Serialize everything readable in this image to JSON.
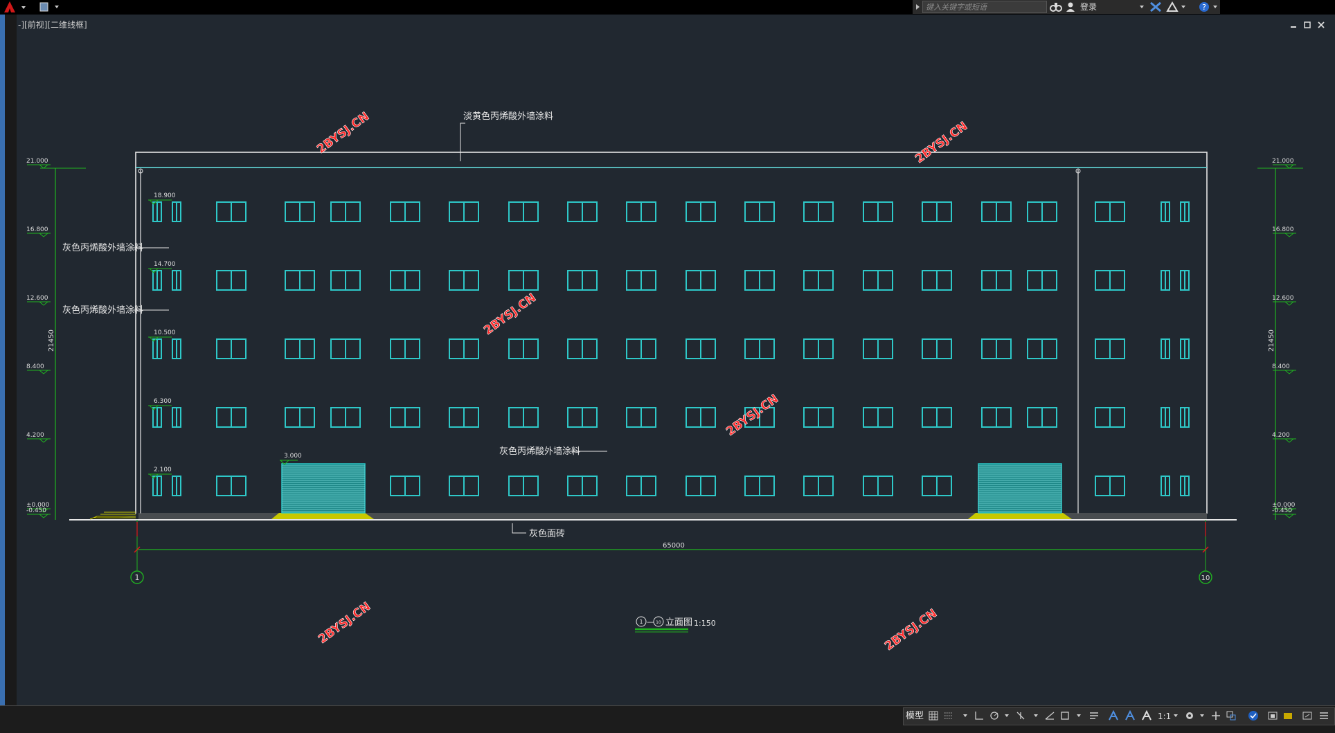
{
  "app": {
    "view_label": "-][前视][二维线框]",
    "search_placeholder": "键入关键字或短语",
    "login_label": "登录"
  },
  "drawing": {
    "watermark": "2BYSJ.CN",
    "left_elevations": [
      "21.000",
      "16.800",
      "12.600",
      "8.400",
      "4.200",
      "±0.000",
      "-0.450"
    ],
    "right_elevations": [
      "21.000",
      "16.800",
      "12.600",
      "8.400",
      "4.200",
      "±0.000",
      "-0.450"
    ],
    "inner_elevations": [
      "18.900",
      "14.700",
      "10.500",
      "6.300",
      "2.100"
    ],
    "door_elevation": "3.000",
    "total_height": "21450",
    "total_width": "65000",
    "axis_start": "1",
    "axis_end": "10",
    "notes": {
      "roof": "淡黄色丙烯酸外墙涂料",
      "wall1": "灰色丙烯酸外墙涂料",
      "wall2": "灰色丙烯酸外墙涂料",
      "wall3": "灰色丙烯酸外墙涂料",
      "base": "灰色面砖"
    },
    "title": {
      "axis_a": "1",
      "axis_b": "10",
      "dash": "—",
      "name": "立面图",
      "scale": "1:150"
    }
  },
  "status": {
    "model_label": "模型",
    "scale_label": "1:1"
  },
  "colors": {
    "window": "#2ec8c8",
    "dimension": "#21b321",
    "wall": "#e6e6e6",
    "door_base": "#c8c800",
    "watermark": "#ff2020"
  }
}
